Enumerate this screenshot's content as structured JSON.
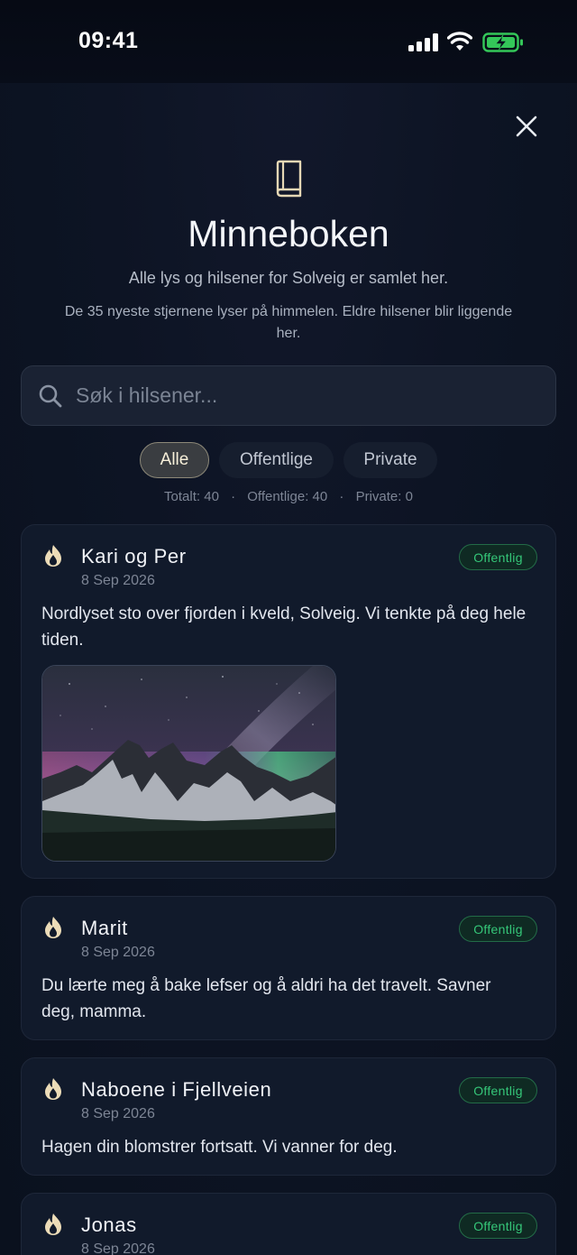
{
  "status_bar": {
    "time": "09:41"
  },
  "header": {
    "title": "Minneboken",
    "subtitle": "Alle lys og hilsener for Solveig er samlet her.",
    "note": "De 35 nyeste stjernene lyser på himmelen. Eldre hilsener blir liggende her."
  },
  "search": {
    "placeholder": "Søk i hilsener..."
  },
  "filters": {
    "all": "Alle",
    "public": "Offentlige",
    "private": "Private",
    "selected": "Alle"
  },
  "counts": {
    "total": "Totalt: 40",
    "public": "Offentlige: 40",
    "private": "Private: 0",
    "separator": "·"
  },
  "messages": [
    {
      "author": "Kari og Per",
      "date": "8 Sep 2026",
      "badge": "Offentlig",
      "text": "Nordlyset sto over fjorden i kveld, Solveig. Vi tenkte på deg hele tiden.",
      "has_photo": true
    },
    {
      "author": "Marit",
      "date": "8 Sep 2026",
      "badge": "Offentlig",
      "text": "Du lærte meg å bake lefser og å aldri ha det travelt. Savner deg, mamma."
    },
    {
      "author": "Naboene i Fjellveien",
      "date": "8 Sep 2026",
      "badge": "Offentlig",
      "text": "Hagen din blomstrer fortsatt. Vi vanner for deg."
    },
    {
      "author": "Jonas",
      "date": "8 Sep 2026",
      "badge": "Offentlig",
      "text": ""
    }
  ],
  "icons": {
    "close": "close-icon",
    "book": "book-icon",
    "search": "search-icon",
    "flame": "candle-flame-icon",
    "signal": "cellular-signal-icon",
    "wifi": "wifi-icon",
    "battery": "battery-charging-icon"
  },
  "colors": {
    "accent_badge": "#35c779",
    "chip_selected_text": "#f7efd9",
    "background": "#0d1424"
  }
}
